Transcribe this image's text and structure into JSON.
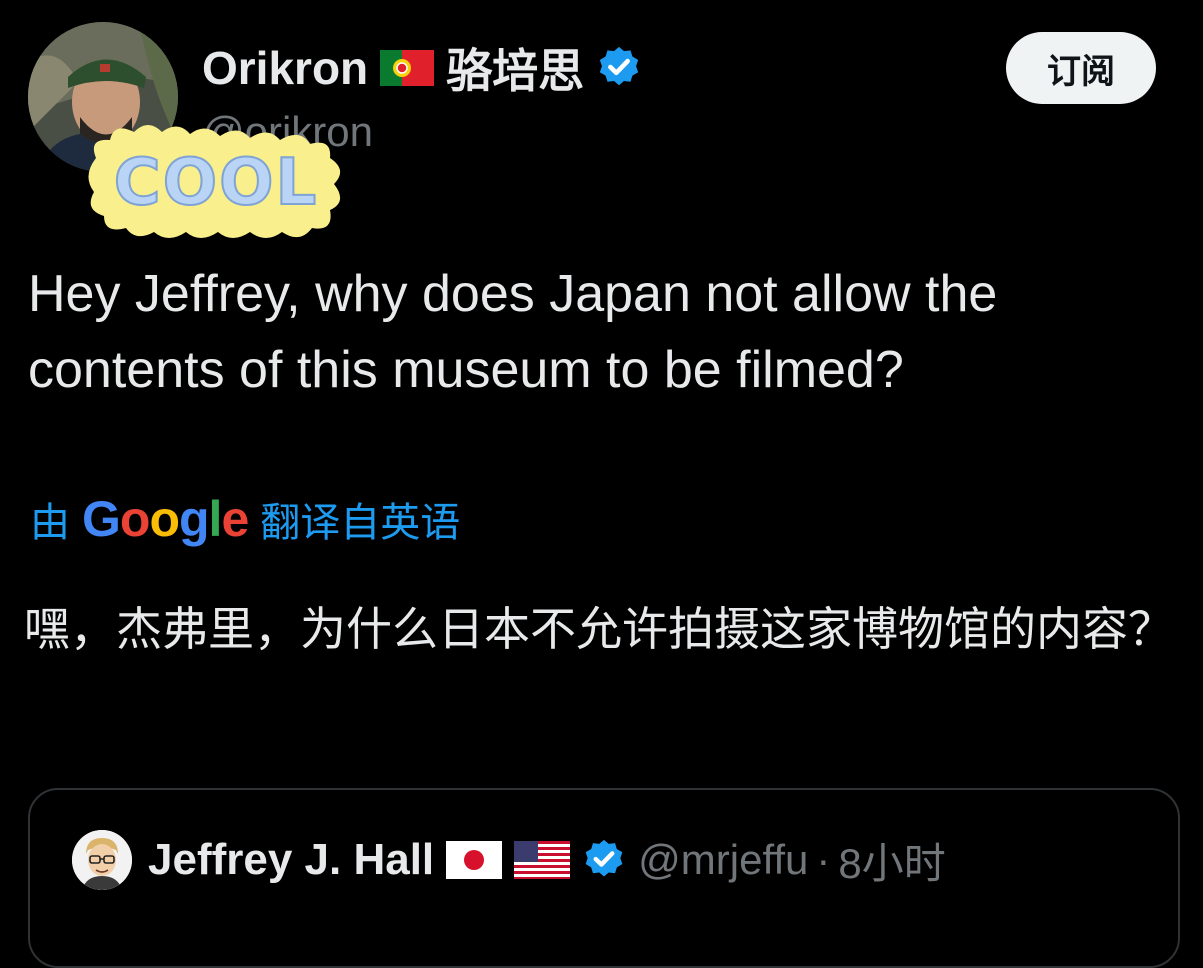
{
  "author": {
    "display_name": "Orikron",
    "chinese_name": "骆培思",
    "handle": "@orikron",
    "flag_icon": "portugal-flag-icon",
    "verified_icon": "verified-badge-icon",
    "verified_color": "#1d9bf0"
  },
  "sticker": {
    "text": "COOL"
  },
  "subscribe_button": {
    "label": "订阅"
  },
  "post": {
    "text": "Hey Jeffrey, why does Japan not allow the contents of this museum to be filmed?"
  },
  "translation": {
    "prefix": "由",
    "google": "Google",
    "suffix": "翻译自英语",
    "link_color": "#1d9bf0"
  },
  "translated_text": "嘿，杰弗里，为什么日本不允许拍摄这家博物馆的内容？",
  "quoted_post": {
    "display_name": "Jeffrey J. Hall",
    "flags": [
      "japan-flag-icon",
      "usa-flag-icon"
    ],
    "handle": "@mrjeffu",
    "separator": "·",
    "time": "8小时"
  }
}
